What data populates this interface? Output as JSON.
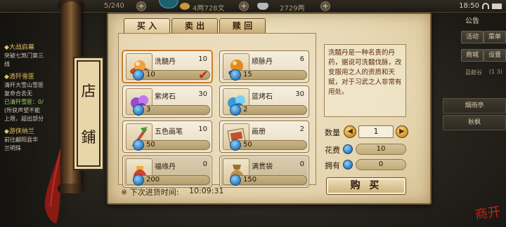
{
  "topbar": {
    "stat_left": "5/240",
    "currency_coins": "4两728文",
    "currency_silver": "2729两",
    "clock": "18:50"
  },
  "quests": [
    {
      "title": "◆大战启幕",
      "lines": [
        "突破七煞门第三",
        "线"
      ]
    },
    {
      "title": "◆清歼雪匪",
      "lines": [
        "清歼大雪山雪匪",
        "复命合去无",
        "已清歼雪匪：0/",
        "(所获声望不能",
        "上限，超出部分"
      ]
    },
    {
      "title": "◆游侠纳兰",
      "lines": [
        "前往翩阳县华",
        "兰明珠"
      ]
    }
  ],
  "right_menu": {
    "notice": "公告",
    "buttons": [
      "活动",
      "菜单",
      "商城",
      "设置"
    ],
    "tag": "蓝献谷",
    "tag_value": "(1 3)",
    "wide_buttons": [
      "烟雨亭",
      "秋枫"
    ]
  },
  "shop": {
    "sign": [
      "店",
      "鋪"
    ],
    "tabs": [
      "买 入",
      "卖 出",
      "赎 回"
    ],
    "items": [
      {
        "name": "洗髓丹",
        "qty": "10",
        "price": "10",
        "icon": "pill-on-tray-icon",
        "selected": true
      },
      {
        "name": "顺脉丹",
        "qty": "6",
        "price": "15",
        "icon": "orange-pill-icon",
        "selected": false
      },
      {
        "name": "紫烤石",
        "qty": "30",
        "price": "3",
        "icon": "purple-gem-icon",
        "selected": false
      },
      {
        "name": "蓝烤石",
        "qty": "30",
        "price": "2",
        "icon": "blue-gem-icon",
        "selected": false
      },
      {
        "name": "五色画笔",
        "qty": "10",
        "price": "50",
        "icon": "brush-icon",
        "selected": false
      },
      {
        "name": "画册",
        "qty": "2",
        "price": "50",
        "icon": "album-icon",
        "selected": false
      },
      {
        "name": "福缘丹",
        "qty": "0",
        "price": "200",
        "icon": "fortune-bag-icon",
        "selected": false
      },
      {
        "name": "满贯袋",
        "qty": "0",
        "price": "150",
        "icon": "money-bag-icon",
        "selected": false
      }
    ],
    "restock_label": "※ 下次进货时间:",
    "restock_time": "10:09:31",
    "description": "洗髓丹是一种名贵的丹药，据说可洗髓伐脉，改变服用之人的资质和天赋，对于习武之人非常有用处。",
    "quantity_label": "数量",
    "quantity_value": "1",
    "cost_label": "花费",
    "cost_value": "10",
    "owned_label": "拥有",
    "owned_value": "0",
    "buy_label": "购 买"
  },
  "seal": "商开"
}
